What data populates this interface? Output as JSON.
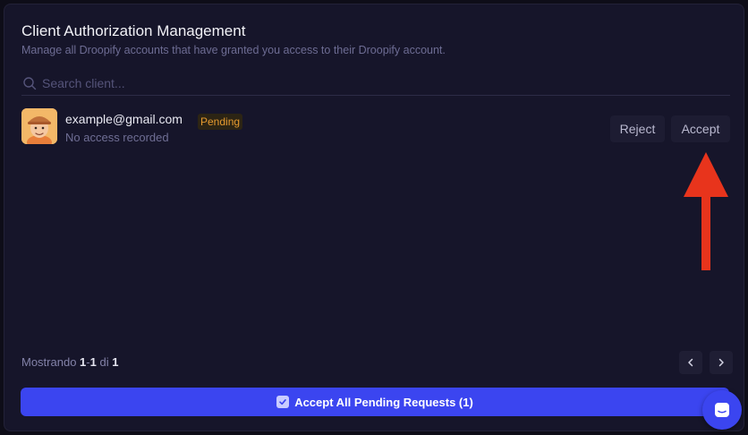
{
  "header": {
    "title": "Client Authorization Management",
    "subtitle": "Manage all Droopify accounts that have granted you access to their Droopify account."
  },
  "search": {
    "placeholder": "Search client...",
    "value": "",
    "icon": "search-icon"
  },
  "clients": [
    {
      "email": "example@gmail.com",
      "status": "Pending",
      "access_text": "No access recorded",
      "reject_label": "Reject",
      "accept_label": "Accept"
    }
  ],
  "pagination": {
    "prefix": "Mostrando",
    "range_start": "1",
    "range_sep": "-",
    "range_end": "1",
    "of": "di",
    "total": "1"
  },
  "bulk_action": {
    "label": "Accept All Pending Requests (1)"
  },
  "colors": {
    "background": "#16152a",
    "accent": "#3b45f0",
    "pending": "#e59a2f",
    "annotation_arrow": "#e8341c"
  }
}
